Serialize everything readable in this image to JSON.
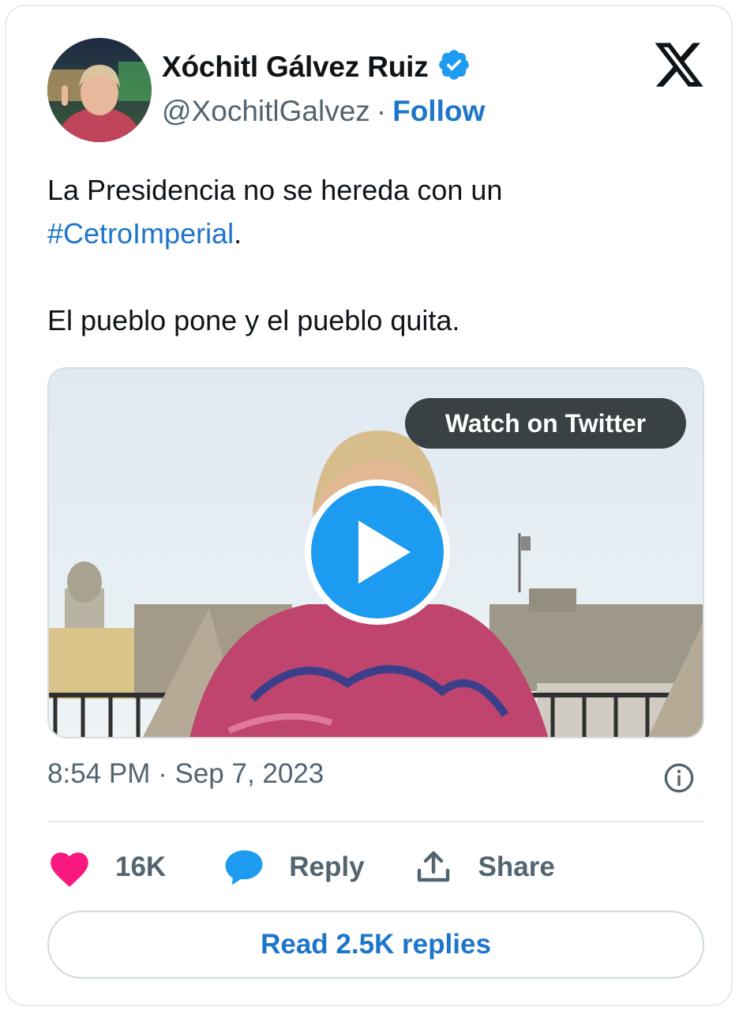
{
  "author": {
    "name": "Xóchitl Gálvez Ruiz",
    "handle": "@XochitlGalvez",
    "separator": "·",
    "follow_label": "Follow",
    "verified": true
  },
  "tweet": {
    "text_line1": "La Presidencia no se hereda con un",
    "hashtag": "#CetroImperial",
    "hashtag_suffix": ".",
    "text_line3": "El pueblo pone y el pueblo quita."
  },
  "media": {
    "watch_label": "Watch on Twitter",
    "play_icon": "play-icon"
  },
  "meta": {
    "time": "8:54 PM",
    "separator": "·",
    "date": "Sep 7, 2023"
  },
  "actions": {
    "likes_count": "16K",
    "reply_label": "Reply",
    "share_label": "Share"
  },
  "read_replies_label": "Read 2.5K replies",
  "colors": {
    "link_blue": "#1d76c9",
    "like_pink": "#f91880",
    "reply_blue": "#1d9bf0",
    "verified_blue": "#1d9bf0",
    "secondary_text": "#536471"
  }
}
